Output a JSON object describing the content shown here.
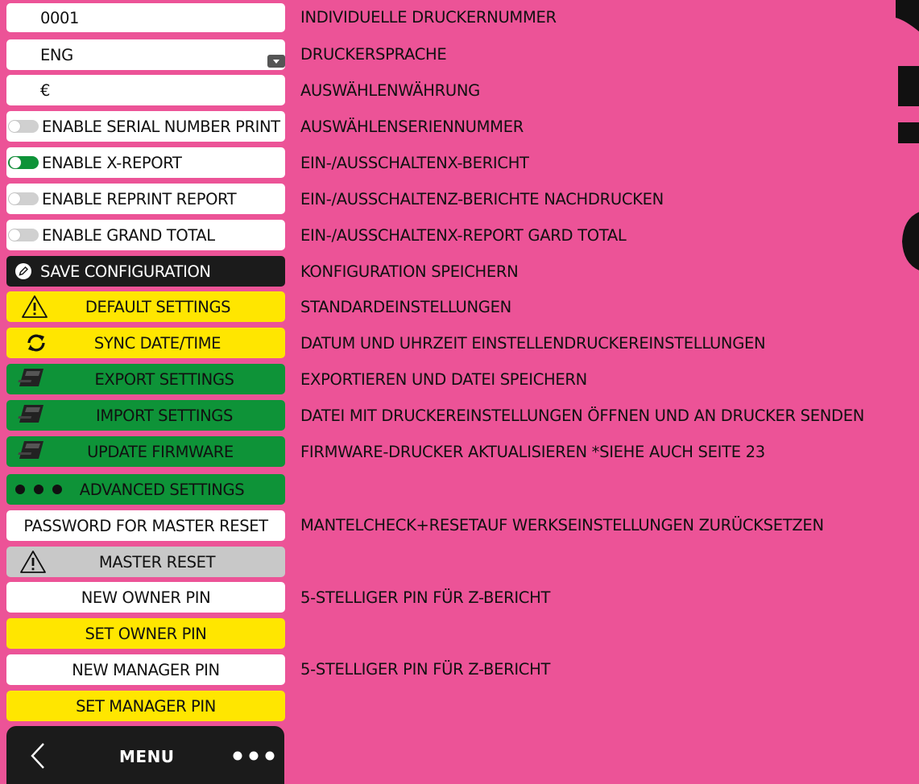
{
  "settings": {
    "printer_number": "0001",
    "language": "ENG",
    "currency": "€",
    "serial_print_label": "ENABLE SERIAL NUMBER PRINT",
    "x_report_label": "ENABLE X-REPORT",
    "reprint_label": "ENABLE REPRINT REPORT",
    "grand_total_label": "ENABLE GRAND TOTAL",
    "save_label": "SAVE CONFIGURATION",
    "default_label": "DEFAULT SETTINGS",
    "sync_label": "SYNC DATE/TIME",
    "export_label": "EXPORT SETTINGS",
    "import_label": "IMPORT SETTINGS",
    "firmware_label": "UPDATE FIRMWARE",
    "advanced_label": "ADVANCED SETTINGS",
    "password_label": "PASSWORD FOR MASTER RESET",
    "master_reset_label": "MASTER RESET",
    "new_owner_pin_label": "NEW OWNER PIN",
    "set_owner_pin_label": "SET OWNER PIN",
    "new_manager_pin_label": "NEW MANAGER PIN",
    "set_manager_pin_label": "SET MANAGER PIN"
  },
  "toggles": {
    "serial_print": false,
    "x_report": true,
    "reprint": false,
    "grand_total": false
  },
  "descriptions": {
    "printer_number": "INDIVIDUELLE DRUCKERNUMMER",
    "language": "DRUCKERSPRACHE",
    "currency": "AUSWÄHLENWÄHRUNG",
    "serial": "AUSWÄHLENSERIENNUMMER",
    "x_report": "EIN-/AUSSCHALTENX-BERICHT",
    "reprint": "EIN-/AUSSCHALTENZ-BERICHTE NACHDRUCKEN",
    "grand_total": "EIN-/AUSSCHALTENX-REPORT GARD TOTAL",
    "save": "KONFIGURATION SPEICHERN",
    "default": "STANDARDEINSTELLUNGEN",
    "sync": "DATUM UND UHRZEIT EINSTELLENDRUCKEREINSTELLUNGEN",
    "export": "EXPORTIEREN UND DATEI SPEICHERN",
    "import": "DATEI MIT DRUCKEREINSTELLUNGEN ÖFFNEN UND AN DRUCKER SENDEN",
    "firmware": "FIRMWARE-DRUCKER AKTUALISIEREN *SIEHE AUCH SEITE 23",
    "password": "MANTELCHECK+RESETAUF WERKSEINSTELLUNGEN ZURÜCKSETZEN",
    "owner_pin": "5-STELLIGER PIN FÜR Z-BERICHT",
    "manager_pin": "5-STELLIGER PIN FÜR Z-BERICHT"
  },
  "bottom_bar": {
    "title": "MENU"
  },
  "colors": {
    "background": "#EC5397",
    "yellow": "#FFE600",
    "green": "#0E9338",
    "black": "#1b1b1b",
    "gray": "#C8C8C8"
  }
}
